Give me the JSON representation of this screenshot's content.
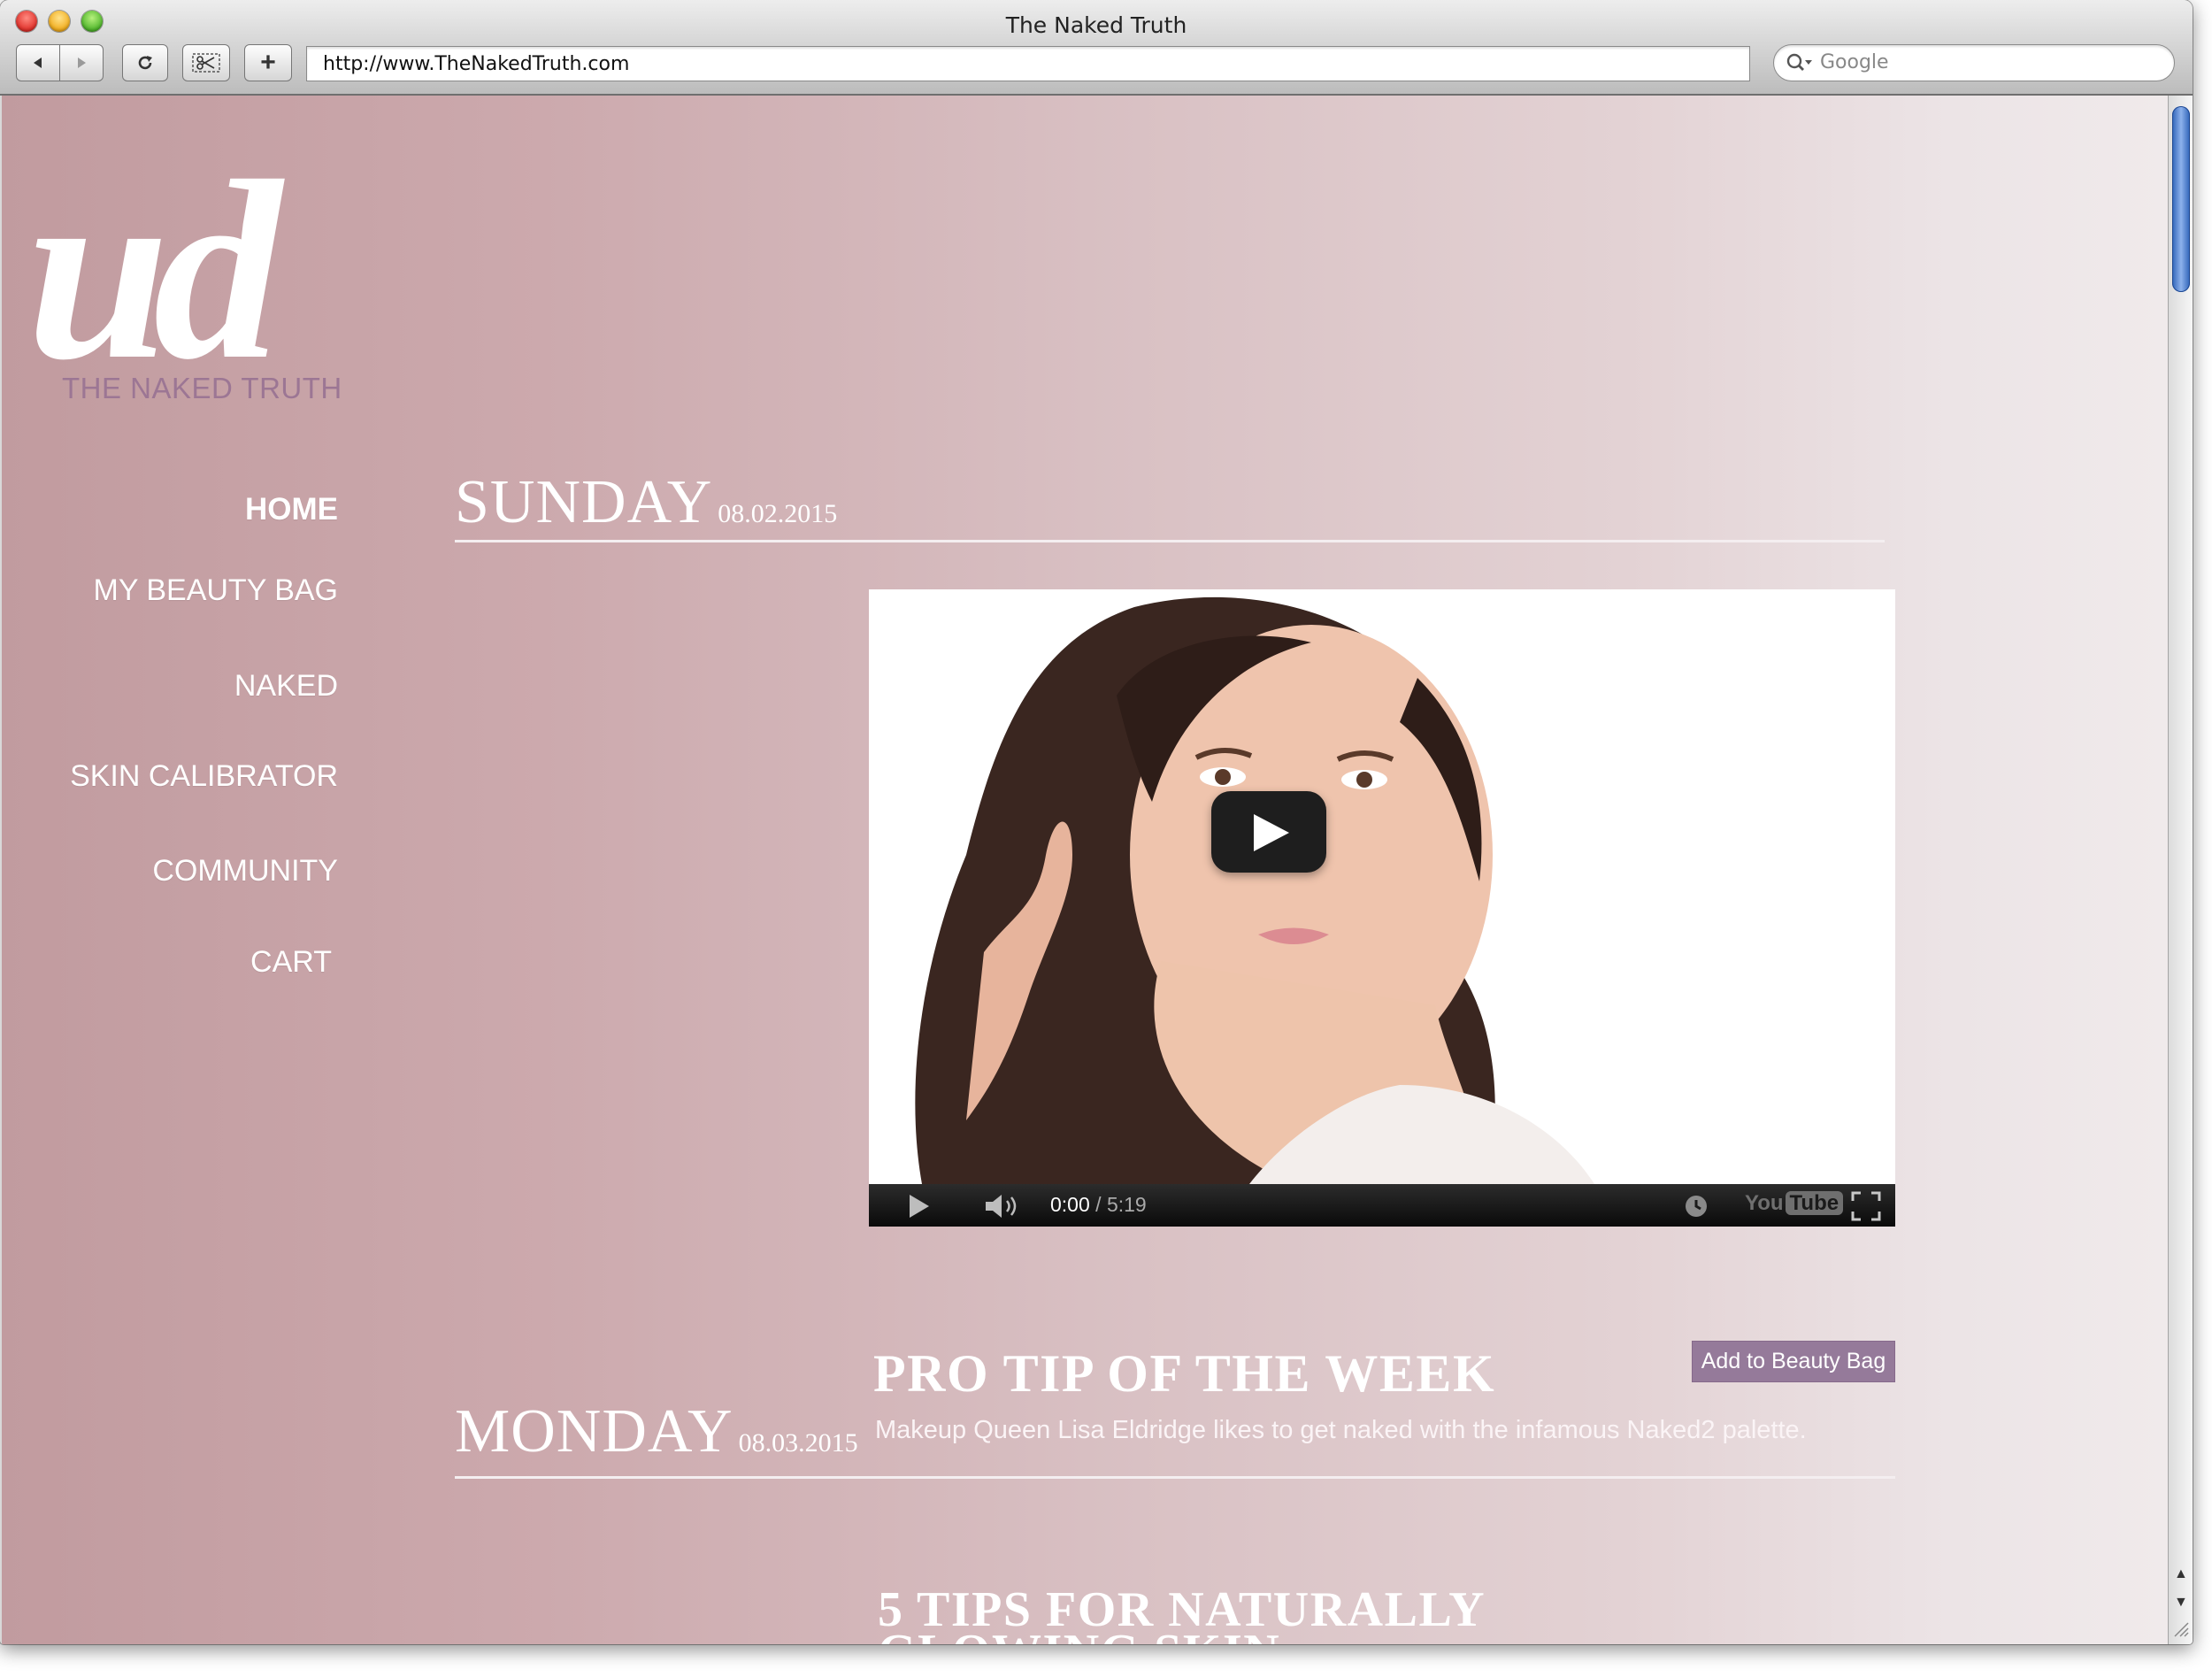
{
  "browser": {
    "window_title": "The Naked Truth",
    "address": "http://www.TheNakedTruth.com",
    "search_placeholder": "Google",
    "buttons": {
      "back_icon": "back-arrow-icon",
      "forward_icon": "forward-arrow-icon",
      "reload_icon": "reload-icon",
      "snip_icon": "scissors-icon",
      "add_tab": "+"
    }
  },
  "site": {
    "brand_tagline": "THE NAKED TRUTH",
    "logo_letters": "ud",
    "nav": [
      {
        "label": "HOME",
        "active": true
      },
      {
        "label": "MY BEAUTY BAG"
      },
      {
        "label": "NAKED"
      },
      {
        "label": "SKIN CALIBRATOR"
      },
      {
        "label": "COMMUNITY"
      },
      {
        "label": "CART"
      }
    ]
  },
  "posts": [
    {
      "day": "SUNDAY",
      "date": "08.02.2015",
      "video": {
        "current_time": "0:00",
        "duration": "5:19",
        "separator": "/",
        "youtube_you": "You",
        "youtube_tube": "Tube"
      },
      "title": "PRO TIP OF THE WEEK",
      "description": "Makeup Queen Lisa Eldridge likes to get naked with the infamous Naked2 palette.",
      "action_label": "Add to Beauty Bag"
    },
    {
      "day": "MONDAY",
      "date": "08.03.2015",
      "title_lines": [
        "5 TIPS FOR NATURALLY",
        "GLOWING SKIN"
      ]
    }
  ],
  "colors": {
    "gradient_left": "#c19b9f",
    "gradient_right": "#f0eaeb",
    "accent_purple": "#957a9a",
    "tagline_purple": "#9c7694"
  }
}
